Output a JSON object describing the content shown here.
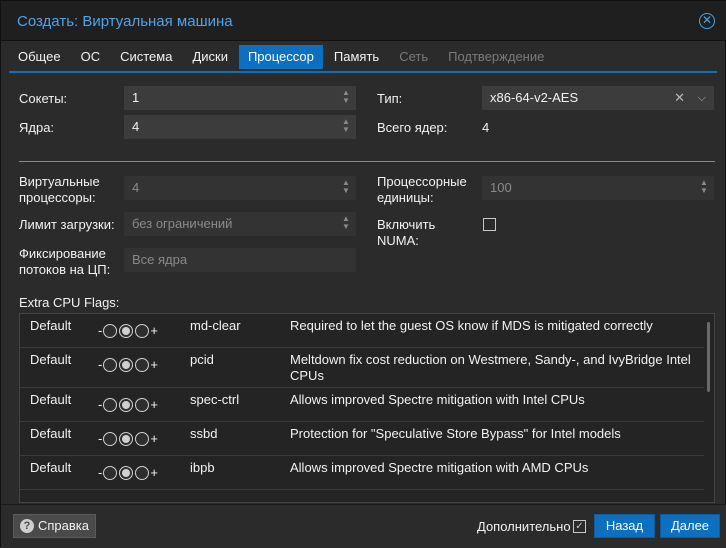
{
  "window": {
    "title": "Создать: Виртуальная машина"
  },
  "tabs": [
    {
      "label": "Общее",
      "state": "normal"
    },
    {
      "label": "ОС",
      "state": "normal"
    },
    {
      "label": "Система",
      "state": "normal"
    },
    {
      "label": "Диски",
      "state": "normal"
    },
    {
      "label": "Процессор",
      "state": "active"
    },
    {
      "label": "Память",
      "state": "normal"
    },
    {
      "label": "Сеть",
      "state": "disabled"
    },
    {
      "label": "Подтверждение",
      "state": "disabled"
    }
  ],
  "form": {
    "sockets_label": "Сокеты:",
    "sockets_value": "1",
    "cores_label": "Ядра:",
    "cores_value": "4",
    "type_label": "Тип:",
    "type_value": "x86-64-v2-AES",
    "total_cores_label": "Всего ядер:",
    "total_cores_value": "4",
    "vcpus_label_1": "Виртуальные",
    "vcpus_label_2": "процессоры:",
    "vcpus_value": "4",
    "cpuunits_label_1": "Процессорные",
    "cpuunits_label_2": "единицы:",
    "cpuunits_value": "100",
    "cpulimit_label": "Лимит загрузки:",
    "cpulimit_value": "без ограничений",
    "numa_label_1": "Включить",
    "numa_label_2": "NUMA:",
    "affinity_label_1": "Фиксирование",
    "affinity_label_2": "потоков на ЦП:",
    "affinity_placeholder": "Все ядра"
  },
  "flags": {
    "title": "Extra CPU Flags:",
    "rows": [
      {
        "state": "Default",
        "name": "md-clear",
        "desc": "Required to let the guest OS know if MDS is mitigated correctly"
      },
      {
        "state": "Default",
        "name": "pcid",
        "desc": "Meltdown fix cost reduction on Westmere, Sandy-, and IvyBridge Intel CPUs"
      },
      {
        "state": "Default",
        "name": "spec-ctrl",
        "desc": "Allows improved Spectre mitigation with Intel CPUs"
      },
      {
        "state": "Default",
        "name": "ssbd",
        "desc": "Protection for \"Speculative Store Bypass\" for Intel models"
      },
      {
        "state": "Default",
        "name": "ibpb",
        "desc": "Allows improved Spectre mitigation with AMD CPUs"
      }
    ],
    "minus": "-",
    "plus": "+"
  },
  "footer": {
    "help_label": "Справка",
    "advanced_label": "Дополнительно",
    "back_label": "Назад",
    "next_label": "Далее"
  },
  "colors": {
    "accent": "#0c6fbf",
    "title": "#4fa3e8"
  }
}
